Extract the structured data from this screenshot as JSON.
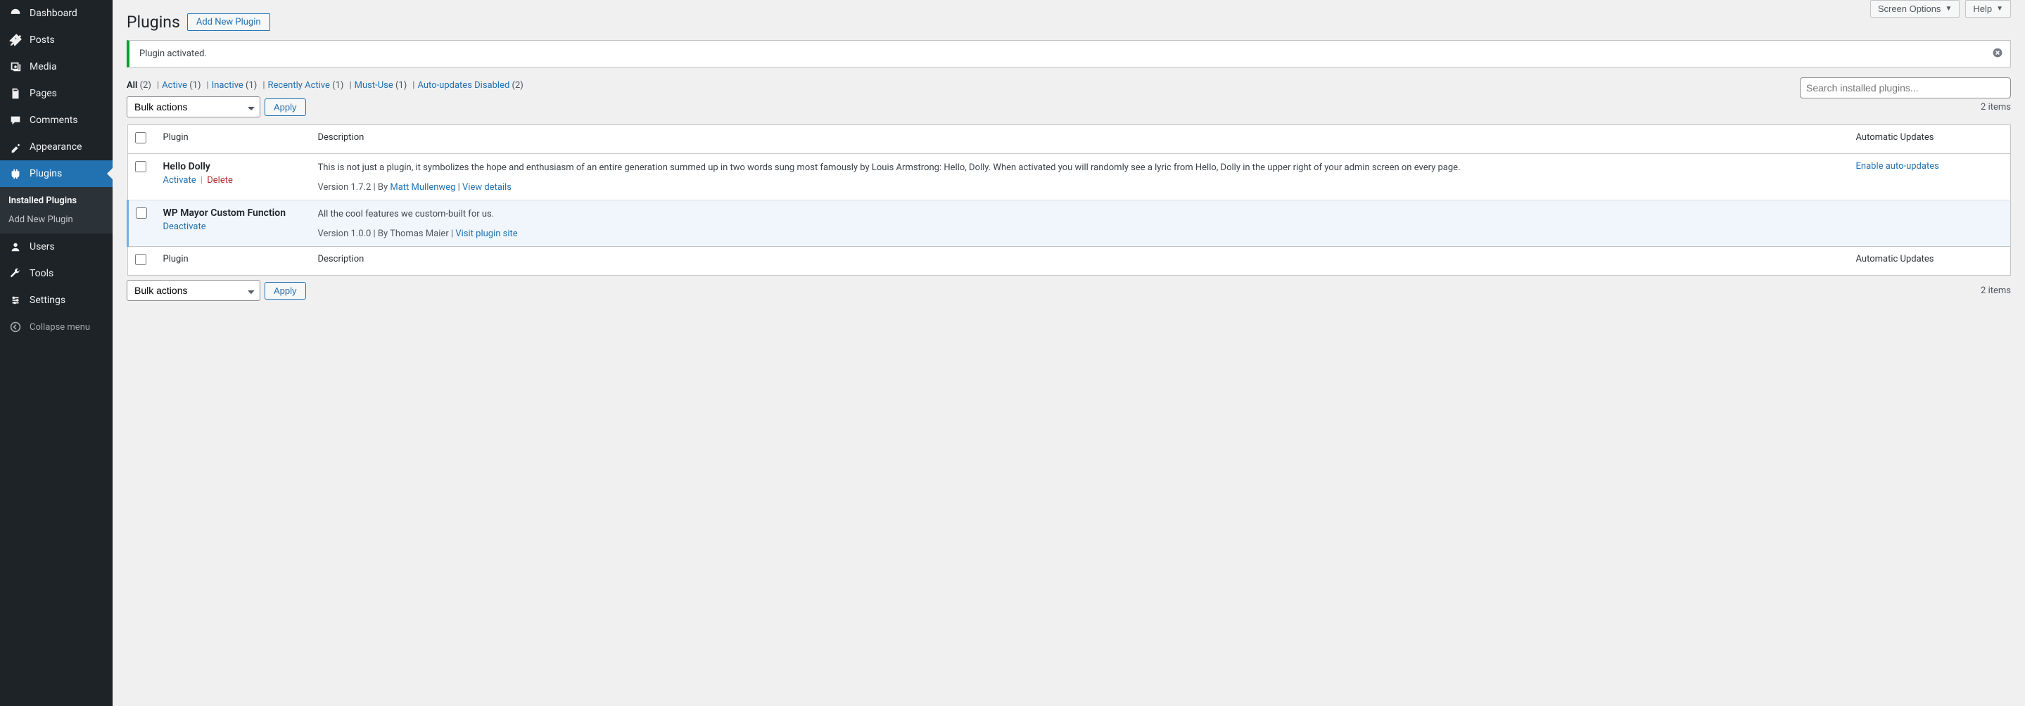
{
  "sidebar": {
    "items": [
      {
        "label": "Dashboard",
        "icon": "dashboard"
      },
      {
        "label": "Posts",
        "icon": "posts"
      },
      {
        "label": "Media",
        "icon": "media"
      },
      {
        "label": "Pages",
        "icon": "pages"
      },
      {
        "label": "Comments",
        "icon": "comments"
      },
      {
        "label": "Appearance",
        "icon": "appearance"
      },
      {
        "label": "Plugins",
        "icon": "plugins",
        "current": true
      },
      {
        "label": "Users",
        "icon": "users"
      },
      {
        "label": "Tools",
        "icon": "tools"
      },
      {
        "label": "Settings",
        "icon": "settings"
      }
    ],
    "submenu": [
      {
        "label": "Installed Plugins",
        "current": true
      },
      {
        "label": "Add New Plugin"
      }
    ],
    "collapse": "Collapse menu"
  },
  "top": {
    "screen_options": "Screen Options",
    "help": "Help"
  },
  "header": {
    "title": "Plugins",
    "action": "Add New Plugin"
  },
  "notice": {
    "text": "Plugin activated."
  },
  "filters": [
    {
      "label": "All",
      "count": "(2)",
      "current": true
    },
    {
      "label": "Active",
      "count": "(1)"
    },
    {
      "label": "Inactive",
      "count": "(1)"
    },
    {
      "label": "Recently Active",
      "count": "(1)"
    },
    {
      "label": "Must-Use",
      "count": "(1)"
    },
    {
      "label": "Auto-updates Disabled",
      "count": "(2)"
    }
  ],
  "search": {
    "placeholder": "Search installed plugins..."
  },
  "bulk": {
    "placeholder": "Bulk actions",
    "apply": "Apply"
  },
  "items_text": "2 items",
  "table": {
    "col_plugin": "Plugin",
    "col_description": "Description",
    "col_auto": "Automatic Updates"
  },
  "plugins": [
    {
      "name": "Hello Dolly",
      "active": false,
      "actions": [
        {
          "label": "Activate",
          "type": "link"
        },
        {
          "label": "Delete",
          "type": "delete"
        }
      ],
      "description": "This is not just a plugin, it symbolizes the hope and enthusiasm of an entire generation summed up in two words sung most famously by Louis Armstrong: Hello, Dolly. When activated you will randomly see a lyric from Hello, Dolly in the upper right of your admin screen on every page.",
      "meta_prefix": "Version 1.7.2 | By ",
      "meta_author": "Matt Mullenweg",
      "meta_sep": " | ",
      "meta_link": "View details",
      "auto": "Enable auto-updates"
    },
    {
      "name": "WP Mayor Custom Function",
      "active": true,
      "actions": [
        {
          "label": "Deactivate",
          "type": "link"
        }
      ],
      "description": "All the cool features we custom-built for us.",
      "meta_prefix": "Version 1.0.0 | By Thomas Maier | ",
      "meta_author": "",
      "meta_sep": "",
      "meta_link": "Visit plugin site",
      "auto": ""
    }
  ]
}
